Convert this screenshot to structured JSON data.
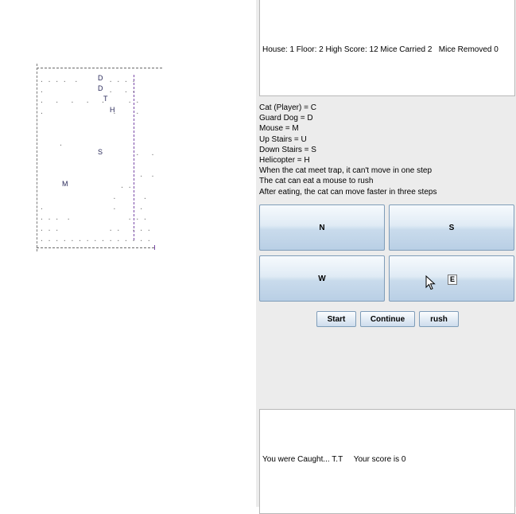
{
  "status": {
    "text": "House: 1 Floor: 2 High Score: 12 Mice Carried 2   Mice Removed 0"
  },
  "legend": [
    "Cat (Player) = C",
    "Guard Dog = D",
    "Mouse = M",
    "Up Stairs = U",
    "Down Stairs = S",
    "Helicopter = H",
    "When the cat meet trap, it can't move in one step",
    "The cat can eat a mouse to rush",
    "After eating, the cat can move faster in three steps"
  ],
  "directions": {
    "north": "N",
    "south": "S",
    "west": "W",
    "east": "E"
  },
  "controls": {
    "start": "Start",
    "continue": "Continue",
    "rush": "rush"
  },
  "message": {
    "text": "You were Caught... T.T     Your score is 0"
  },
  "board": {
    "glyphs": {
      "dog1": "D",
      "dog2": "D",
      "trap": "T",
      "helicopter": "H",
      "stairs_down": "S",
      "mouse": "M"
    }
  },
  "icons": {
    "cursor": "mouse-pointer-icon"
  }
}
